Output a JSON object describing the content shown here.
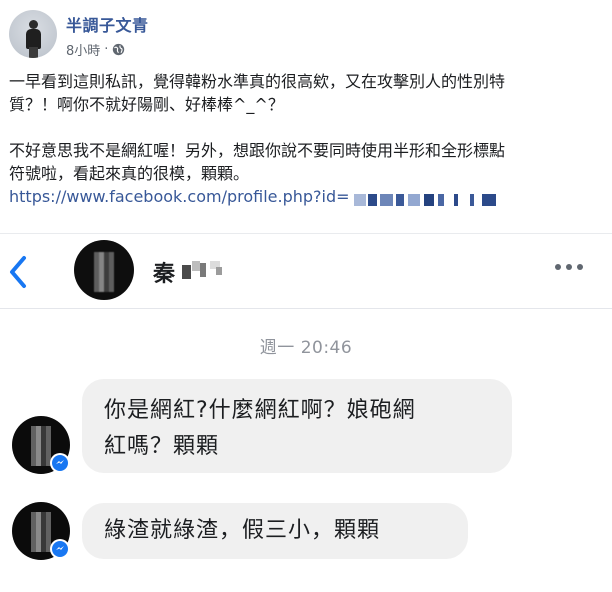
{
  "post": {
    "author_name": "半調子文青",
    "time_ago": "8小時",
    "separator": "·",
    "icon": "globe-icon",
    "line1": "一早看到這則私訊，覺得韓粉水準真的很高欸，又在攻擊別人的性別特",
    "line2": "質？！啊你不就好陽剛、好棒棒^_^？",
    "line3": "不好意思我不是網紅喔！另外，想跟你說不要同時使用半形和全形標點",
    "line4": "符號啦，看起來真的很模，顆顆。",
    "link_text": "https://www.facebook.com/profile.php?id="
  },
  "messenger": {
    "back_icon": "chevron-left-icon",
    "contact_name": "秦",
    "more_icon": "more-dots-icon",
    "timestamp": "週一 20:46",
    "messages": [
      {
        "line1": "你是網紅?什麼網紅啊？娘砲網",
        "line2": "紅嗎？顆顆"
      },
      {
        "line1": "綠渣就綠渣，假三小，顆顆"
      }
    ],
    "badge_icon": "messenger-icon"
  },
  "colors": {
    "link": "#385898",
    "messenger_blue": "#1877f2",
    "bubble": "#f0f0f0",
    "meta_gray": "#606770"
  }
}
